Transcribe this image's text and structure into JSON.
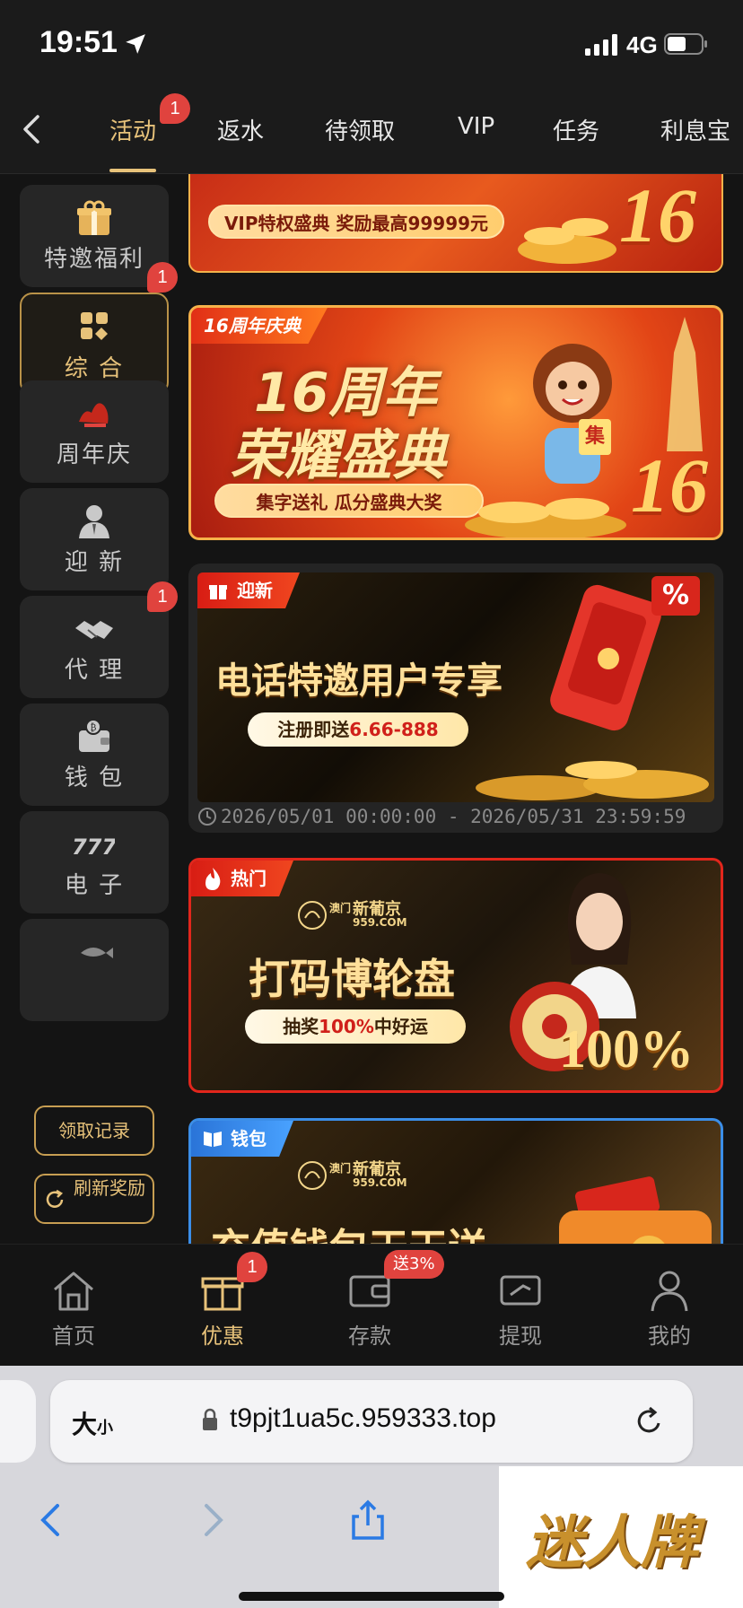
{
  "status": {
    "time": "19:51",
    "network": "4G"
  },
  "tabs": [
    {
      "label": "活动",
      "badge": "1",
      "active": true
    },
    {
      "label": "返水"
    },
    {
      "label": "待领取"
    },
    {
      "label": "VIP"
    },
    {
      "label": "任务"
    },
    {
      "label": "利息宝"
    }
  ],
  "sidebar": {
    "items": [
      {
        "label": "特邀福利",
        "icon": "gift-box-icon"
      },
      {
        "label": "综 合",
        "icon": "grid-icon",
        "badge": "1",
        "active": true
      },
      {
        "label": "周年庆",
        "icon": "anniversary-logo-icon"
      },
      {
        "label": "迎 新",
        "icon": "person-icon"
      },
      {
        "label": "代 理",
        "icon": "handshake-icon",
        "badge": "1"
      },
      {
        "label": "钱 包",
        "icon": "wallet-icon"
      },
      {
        "label": "电 子",
        "icon": "slot-777-icon"
      }
    ],
    "record_button": "领取记录",
    "refresh_button": "刷新奖励"
  },
  "banners": {
    "b1": {
      "subtitle": "VIP特权盛典 奖励最高99999元",
      "big": "16"
    },
    "b2": {
      "ribbon": "16周年庆典",
      "line1": "16周年",
      "line2": "荣耀盛典",
      "pill": "集字送礼 瓜分盛典大奖",
      "tag": "集",
      "big": "16"
    },
    "b3": {
      "ribbon": "迎新",
      "title": "电话特邀用户专享",
      "pill_prefix": "注册即送",
      "pill_value": "6.66-888",
      "percent": "%",
      "date_range": "2026/05/01 00:00:00 - 2026/05/31 23:59:59"
    },
    "b4": {
      "ribbon": "热门",
      "logo_cn": "新葡京",
      "logo_site": "959.COM",
      "logo_tag": "澳门",
      "title": "打码博轮盘",
      "pill_prefix": "抽奖",
      "pill_value": "100%",
      "pill_suffix": "中好运",
      "big": "100%"
    },
    "b5": {
      "ribbon": "钱包",
      "logo_cn": "新葡京",
      "logo_site": "959.COM",
      "logo_tag": "澳门",
      "title": "充值钱包天天送"
    }
  },
  "bottom_nav": [
    {
      "label": "首页",
      "icon": "home-icon"
    },
    {
      "label": "优惠",
      "icon": "gift-icon",
      "badge": "1",
      "active": true
    },
    {
      "label": "存款",
      "icon": "deposit-wallet-icon",
      "badge": "送3%"
    },
    {
      "label": "提现",
      "icon": "withdraw-ticket-icon"
    },
    {
      "label": "我的",
      "icon": "profile-icon"
    }
  ],
  "browser": {
    "size_label": "大",
    "size_small": "小",
    "url": "t9pjt1ua5c.959333.top"
  },
  "watermark": "迷人牌",
  "colors": {
    "accent_gold": "#e7c27a",
    "badge_red": "#e0433e",
    "background": "#141414"
  }
}
